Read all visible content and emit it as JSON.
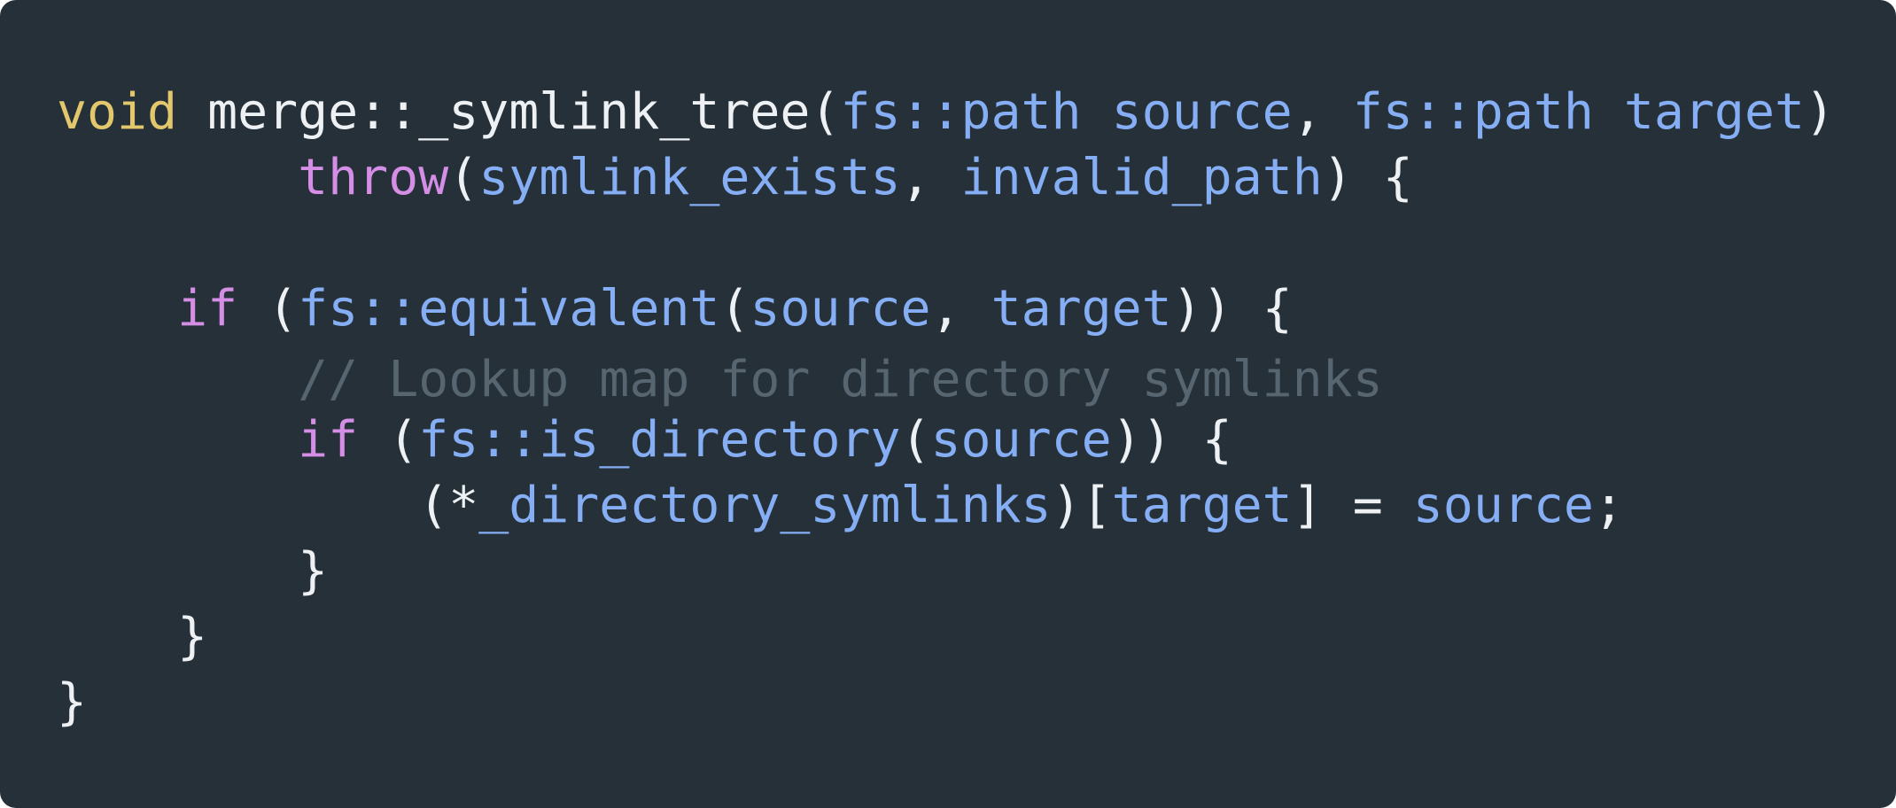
{
  "colors": {
    "background": "#263038",
    "plain": "#eef1f4",
    "keyword": "#e2c76c",
    "control": "#d58ee6",
    "identifier": "#86aef4",
    "comment": "#56656f"
  },
  "code": {
    "lines": [
      [
        {
          "t": "void",
          "c": "keyword"
        },
        {
          "t": " merge::_symlink_tree(",
          "c": "plain"
        },
        {
          "t": "fs::path source",
          "c": "identifier"
        },
        {
          "t": ", ",
          "c": "plain"
        },
        {
          "t": "fs::path target",
          "c": "identifier"
        },
        {
          "t": ")",
          "c": "plain"
        }
      ],
      [
        {
          "t": "        ",
          "c": "plain"
        },
        {
          "t": "throw",
          "c": "control"
        },
        {
          "t": "(",
          "c": "plain"
        },
        {
          "t": "symlink_exists",
          "c": "identifier"
        },
        {
          "t": ", ",
          "c": "plain"
        },
        {
          "t": "invalid_path",
          "c": "identifier"
        },
        {
          "t": ") {",
          "c": "plain"
        }
      ],
      [],
      [
        {
          "t": "    ",
          "c": "plain"
        },
        {
          "t": "if",
          "c": "control"
        },
        {
          "t": " (",
          "c": "plain"
        },
        {
          "t": "fs::equivalent",
          "c": "identifier"
        },
        {
          "t": "(",
          "c": "plain"
        },
        {
          "t": "source",
          "c": "identifier"
        },
        {
          "t": ", ",
          "c": "plain"
        },
        {
          "t": "target",
          "c": "identifier"
        },
        {
          "t": ")) {",
          "c": "plain"
        }
      ],
      [
        {
          "t": "        ",
          "c": "plain"
        },
        {
          "t": "// Lookup map for directory symlinks",
          "c": "comment"
        }
      ],
      [
        {
          "t": "        ",
          "c": "plain"
        },
        {
          "t": "if",
          "c": "control"
        },
        {
          "t": " (",
          "c": "plain"
        },
        {
          "t": "fs::is_directory",
          "c": "identifier"
        },
        {
          "t": "(",
          "c": "plain"
        },
        {
          "t": "source",
          "c": "identifier"
        },
        {
          "t": ")) {",
          "c": "plain"
        }
      ],
      [
        {
          "t": "            (*",
          "c": "plain"
        },
        {
          "t": "_directory_symlinks",
          "c": "identifier"
        },
        {
          "t": ")[",
          "c": "plain"
        },
        {
          "t": "target",
          "c": "identifier"
        },
        {
          "t": "] = ",
          "c": "plain"
        },
        {
          "t": "source",
          "c": "identifier"
        },
        {
          "t": ";",
          "c": "plain"
        }
      ],
      [
        {
          "t": "        }",
          "c": "plain"
        }
      ],
      [
        {
          "t": "    }",
          "c": "plain"
        }
      ],
      [
        {
          "t": "}",
          "c": "plain"
        }
      ]
    ]
  }
}
